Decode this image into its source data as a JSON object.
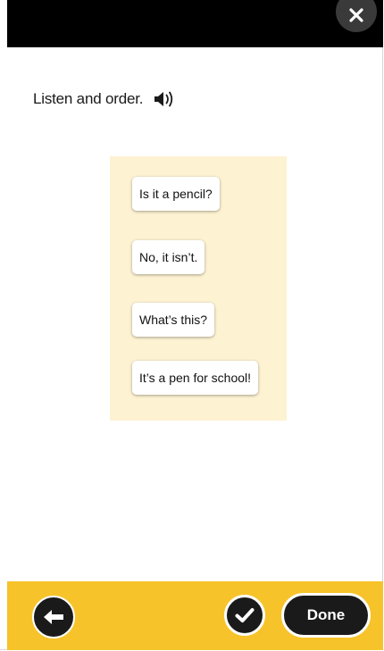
{
  "header": {
    "close_icon": "close-icon"
  },
  "instruction": {
    "text": "Listen and order.",
    "audio_icon": "speaker-icon"
  },
  "sentences": [
    {
      "text": "Is it a pencil?"
    },
    {
      "text": "No, it isn’t."
    },
    {
      "text": "What’s this?"
    },
    {
      "text": "It’s a pen for school!"
    }
  ],
  "footer": {
    "back_icon": "arrow-left-icon",
    "check_icon": "checkmark-icon",
    "done_label": "Done"
  },
  "colors": {
    "topbar": "#000000",
    "panel": "#fdf2d2",
    "footer": "#f6c32a",
    "button": "#1a1a1a"
  }
}
